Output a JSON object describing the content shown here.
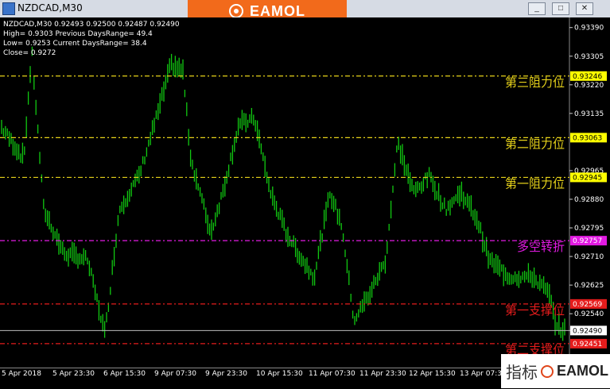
{
  "window": {
    "title": "NZDCAD,M30",
    "buttons": [
      "_",
      "□",
      "✕"
    ]
  },
  "brand": {
    "name": "EAMOL",
    "watermark_cn": "指标",
    "watermark_name": "EAMOL"
  },
  "info": {
    "header": "NZDCAD,M30  0.92493 0.92500 0.92487 0.92490",
    "line1": "High= 0.9303 Previous DaysRange= 49.4",
    "line2": "Low= 0.9253 Current DaysRange= 38.4",
    "line3": "Close= 0.9272"
  },
  "y_axis": {
    "ticks": [
      "0.93390",
      "0.93305",
      "0.93220",
      "0.93135",
      "0.92965",
      "0.92880",
      "0.92795",
      "0.92710",
      "0.92625",
      "0.92540",
      "0.92490"
    ]
  },
  "x_axis": {
    "ticks": [
      "5 Apr 2018",
      "5 Apr 23:30",
      "6 Apr 15:30",
      "9 Apr 07:30",
      "9 Apr 23:30",
      "10 Apr 15:30",
      "11 Apr 07:30",
      "11 Apr 23:30",
      "12 Apr 15:30",
      "13 Apr 07:30"
    ]
  },
  "levels": [
    {
      "label": "第三阻力位",
      "price": "0.93246",
      "color": "#e6d21a",
      "badge": "#ffff00",
      "badge_text": "#000000"
    },
    {
      "label": "第二阻力位",
      "price": "0.93063",
      "color": "#e6d21a",
      "badge": "#ffff00",
      "badge_text": "#000000"
    },
    {
      "label": "第一阻力位",
      "price": "0.92945",
      "color": "#e6d21a",
      "badge": "#ffff00",
      "badge_text": "#000000"
    },
    {
      "label": "多空转折",
      "price": "0.92757",
      "color": "#e21ae2",
      "badge": "#e21ae2",
      "badge_text": "#ffffff"
    },
    {
      "label": "第一支撑位",
      "price": "0.92569",
      "color": "#e51c1c",
      "badge": "#e51c1c",
      "badge_text": "#ffffff"
    },
    {
      "label": "第二支撑位",
      "price": "0.92451",
      "color": "#e51c1c",
      "badge": "#e51c1c",
      "badge_text": "#ffffff"
    }
  ],
  "current_price": "0.92490",
  "colors": {
    "candle": "#11c811",
    "background": "#000000",
    "brand": "#f26a1b"
  }
}
